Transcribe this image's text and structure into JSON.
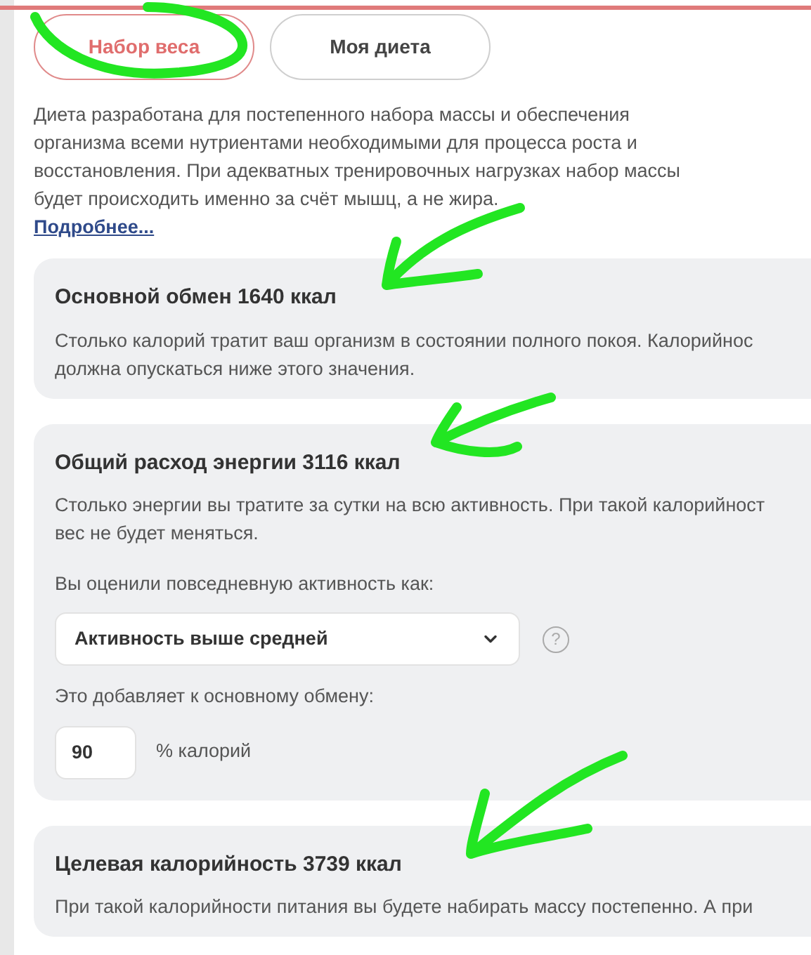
{
  "tabs": [
    {
      "label": "Набор веса",
      "selected": true
    },
    {
      "label": "Моя диета",
      "selected": false
    }
  ],
  "intro": {
    "lines": [
      "Диета разработана для постепенного набора массы и обеспечения",
      "организма всеми нутриентами необходимыми для процесса роста и",
      "восстановления. При адекватных тренировочных нагрузках набор массы",
      "будет происходить именно за счёт мышц, а не жира."
    ],
    "link": "Подробнее..."
  },
  "cards": [
    {
      "title": "Основной обмен 1640 ккал",
      "lines": [
        "Столько калорий тратит ваш организм в состоянии полного покоя. Калорийнос",
        "должна опускаться ниже этого значения."
      ]
    },
    {
      "title": "Общий расход энергии 3116 ккал",
      "lines": [
        "Столько энергии вы тратите за сутки на всю активность. При такой калорийност",
        "вес не будет меняться."
      ],
      "activity": {
        "label": "Вы оценили повседневную активность как:",
        "value": "Активность выше средней",
        "help": "?",
        "added_label": "Это добавляет к основному обмену:",
        "percent": "90",
        "percent_unit": "% калорий"
      }
    },
    {
      "title": "Целевая калорийность 3739 ккал",
      "lines": [
        "При такой калорийности питания вы будете набирать массу постепенно. А при"
      ]
    }
  ]
}
